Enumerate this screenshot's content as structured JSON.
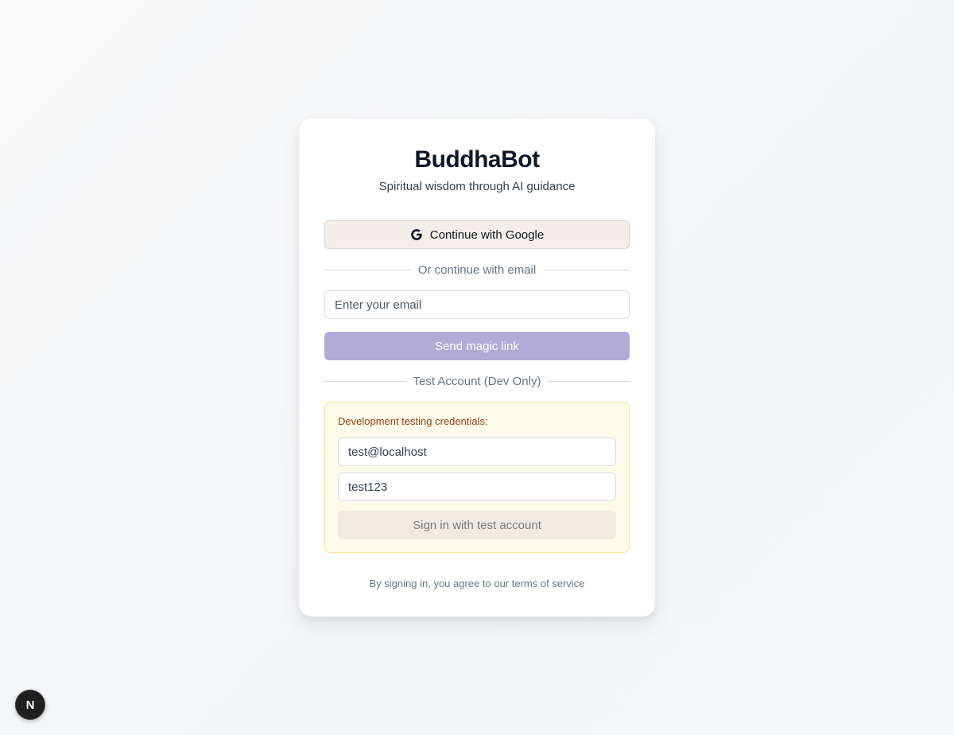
{
  "app": {
    "title": "BuddhaBot",
    "subtitle": "Spiritual wisdom through AI guidance"
  },
  "google": {
    "label": "Continue with Google",
    "icon": "google-icon"
  },
  "email_divider": {
    "label": "Or continue with email"
  },
  "email": {
    "placeholder": "Enter your email",
    "value": ""
  },
  "magic_link": {
    "label": "Send magic link"
  },
  "test_divider": {
    "label": "Test Account (Dev Only)"
  },
  "dev": {
    "label": "Development testing credentials:",
    "email_value": "test@localhost",
    "password_value": "test123",
    "signin_label": "Sign in with test account"
  },
  "terms": {
    "text": "By signing in, you agree to our terms of service"
  },
  "badge": {
    "letter": "N",
    "icon": "nextjs-icon"
  },
  "colors": {
    "magic_button": "#b1a9d6",
    "google_button": "#f3efe8",
    "dev_box": "#fffbea",
    "dev_border": "#fbe38e",
    "dev_label": "#92400e"
  }
}
